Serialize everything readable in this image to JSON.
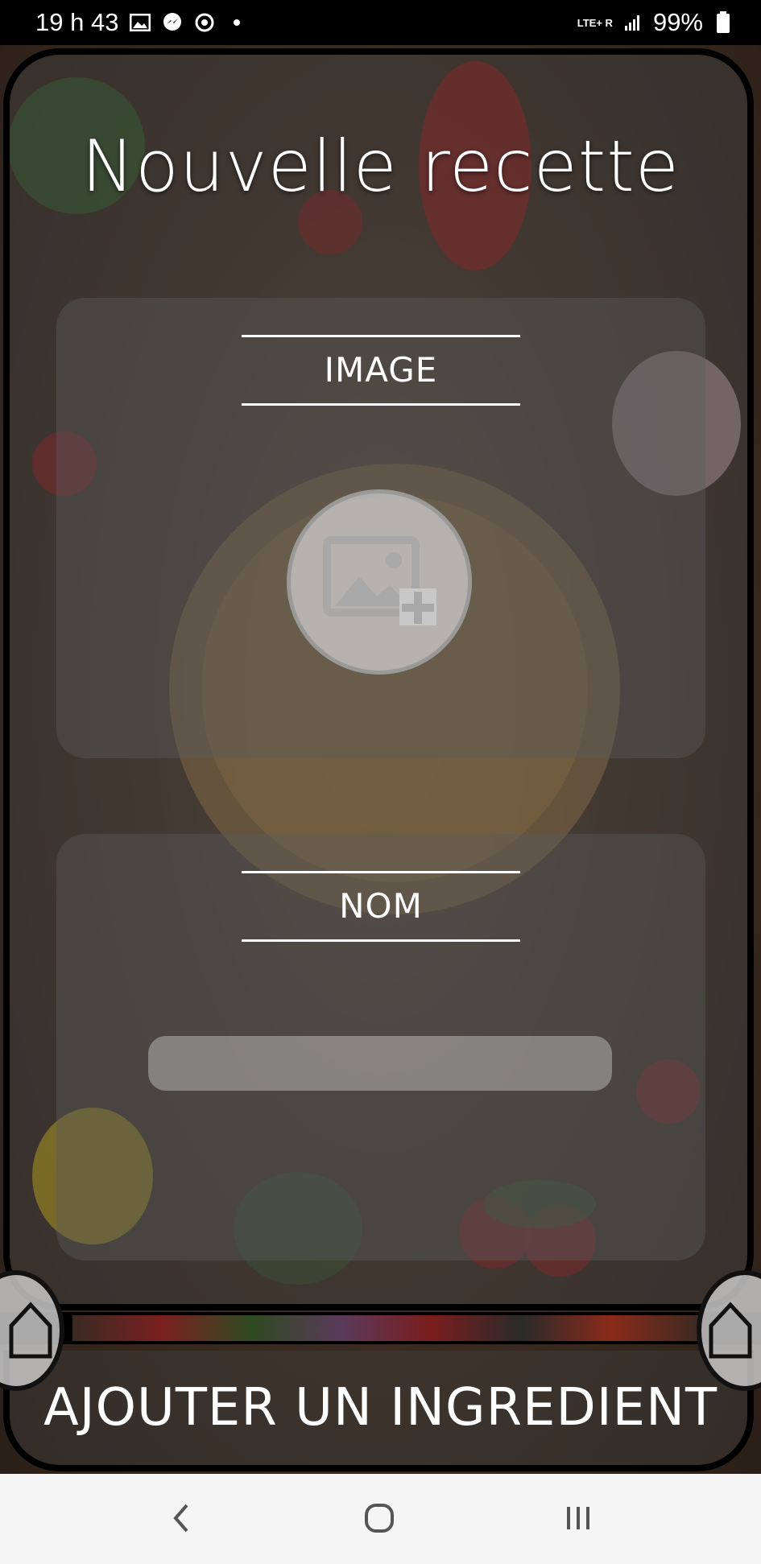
{
  "status_bar": {
    "time": "19 h 43",
    "network": "LTE+ R",
    "battery": "99%",
    "icons": [
      "image-icon",
      "messenger-icon",
      "whatsapp-icon",
      "dot-icon",
      "signal-icon",
      "battery-icon"
    ]
  },
  "screen": {
    "title": "Nouvelle recette"
  },
  "image_section": {
    "title": "IMAGE",
    "picker_icon": "add-photo-icon"
  },
  "name_section": {
    "title": "NOM",
    "input_value": "",
    "input_placeholder": ""
  },
  "bottom": {
    "add_ingredient_label": "AJOUTER UN INGREDIENT",
    "home_icon": "home-icon"
  },
  "navigation": {
    "back_icon": "back-icon",
    "home_icon": "home-circle-icon",
    "recents_icon": "recents-icon"
  },
  "colors": {
    "overlay": "#5a5a5a",
    "text": "#ffffff",
    "nav_bar": "#f5f5f5"
  }
}
